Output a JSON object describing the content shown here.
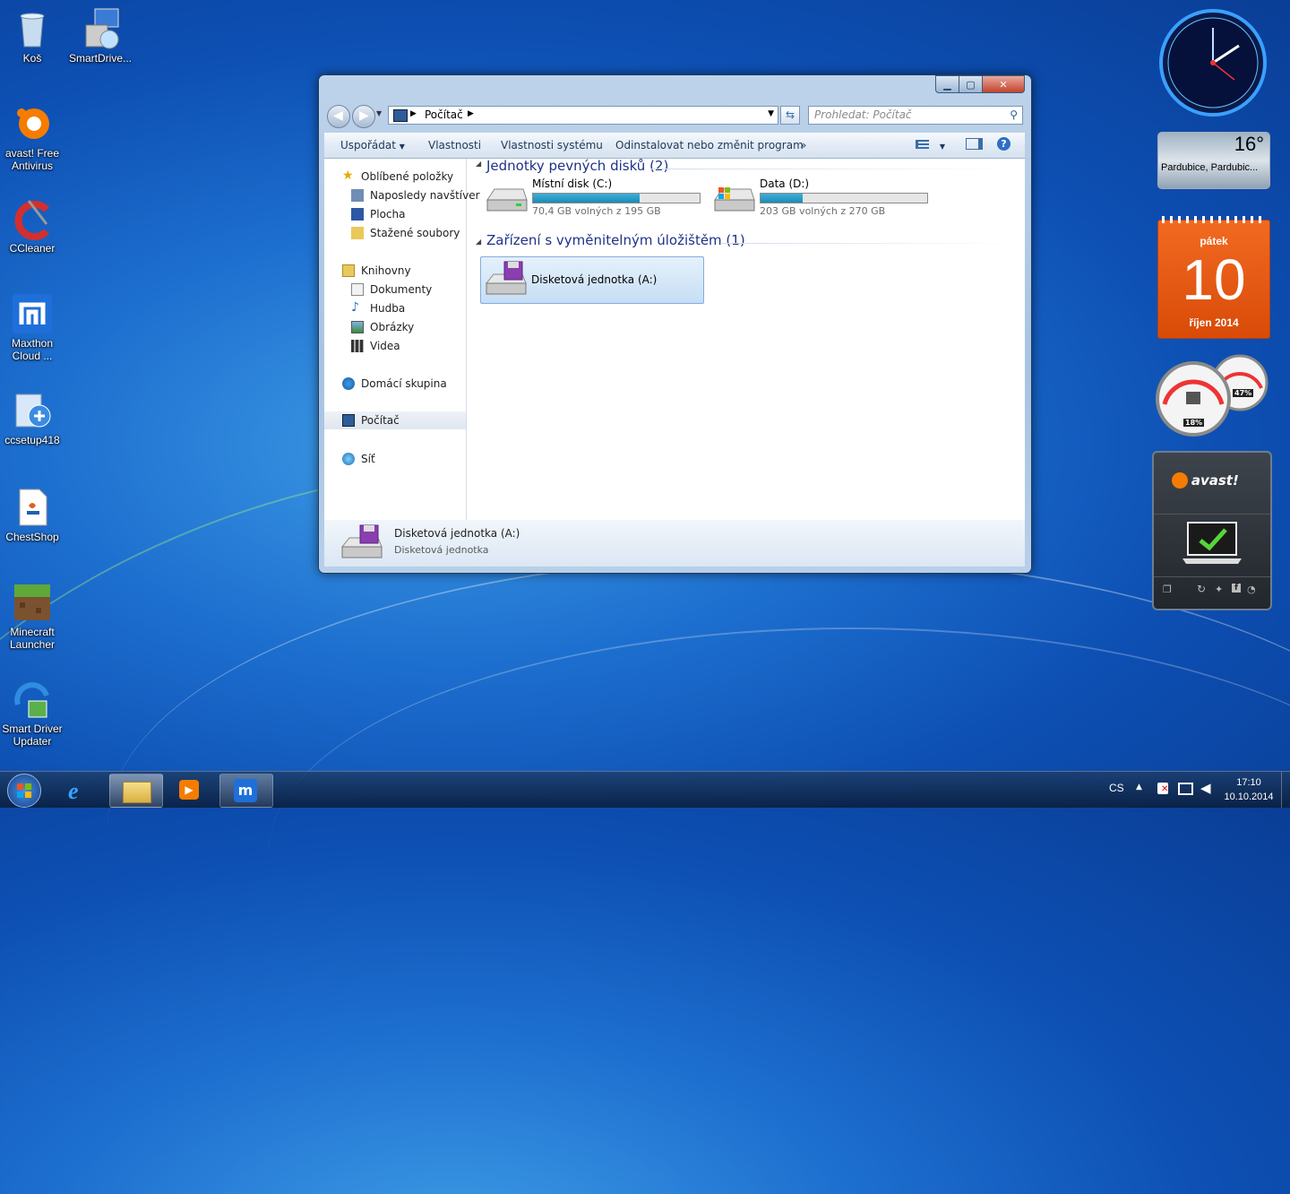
{
  "desktop": {
    "icons": [
      {
        "label": "Koš"
      },
      {
        "label": "SmartDrive..."
      },
      {
        "label": "avast! Free Antivirus"
      },
      {
        "label": "CCleaner"
      },
      {
        "label": "Maxthon Cloud ..."
      },
      {
        "label": "ccsetup418"
      },
      {
        "label": "ChestShop"
      },
      {
        "label": "Minecraft Launcher"
      },
      {
        "label": "Smart Driver Updater"
      }
    ]
  },
  "explorer": {
    "breadcrumb": "Počítač",
    "search_placeholder": "Prohledat: Počítač",
    "toolbar": {
      "organize": "Uspořádat",
      "properties": "Vlastnosti",
      "system_properties": "Vlastnosti systému",
      "uninstall": "Odinstalovat nebo změnit program",
      "more": "»"
    },
    "nav": {
      "favorites": "Oblíbené položky",
      "recent": "Naposledy navštíver",
      "desktop": "Plocha",
      "downloads": "Stažené soubory",
      "libraries": "Knihovny",
      "documents": "Dokumenty",
      "music": "Hudba",
      "pictures": "Obrázky",
      "videos": "Videa",
      "homegroup": "Domácí skupina",
      "computer": "Počítač",
      "network": "Síť"
    },
    "groups": {
      "hard_disks": "Jednotky pevných disků (2)",
      "removable": "Zařízení s vyměnitelným úložištěm (1)"
    },
    "drives": [
      {
        "name": "Místní disk (C:)",
        "info": "70,4 GB volných z 195 GB",
        "used_fraction": 0.64
      },
      {
        "name": "Data (D:)",
        "info": "203 GB volných z 270 GB",
        "used_fraction": 0.25
      }
    ],
    "floppy": {
      "name": "Disketová jednotka (A:)"
    },
    "details": {
      "title": "Disketová jednotka (A:)",
      "subtitle": "Disketová jednotka"
    }
  },
  "gadgets": {
    "weather": {
      "temp": "16°",
      "location": "Pardubice, Pardubic..."
    },
    "calendar": {
      "day_name": "pátek",
      "day": "10",
      "month_year": "říjen 2014"
    },
    "meter": {
      "cpu": "18%",
      "ram": "47%"
    },
    "avast": {
      "brand": "avast!"
    }
  },
  "taskbar": {
    "language": "CS",
    "time": "17:10",
    "date": "10.10.2014"
  },
  "colors": {
    "accent": "#1e3287",
    "drive_bar": "#1b8ab5",
    "calendar": "#e85a10"
  }
}
